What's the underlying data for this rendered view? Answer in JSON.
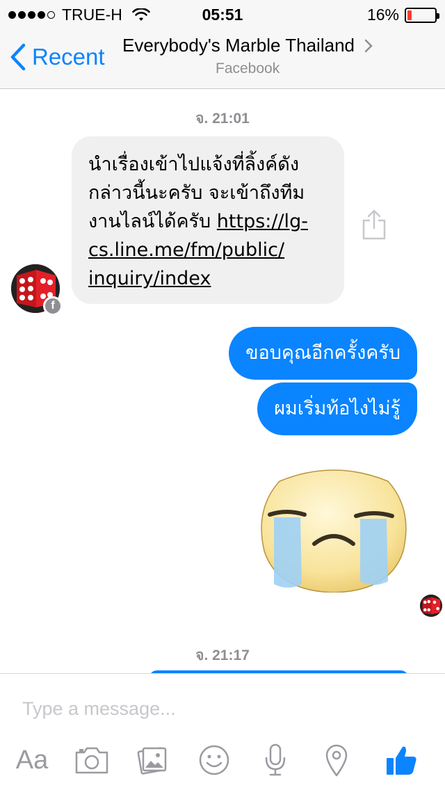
{
  "status_bar": {
    "carrier": "TRUE-H",
    "time": "05:51",
    "battery_percent": "16%",
    "battery_level": 0.16,
    "signal_icon": "signal-dots-icon",
    "wifi_icon": "wifi-icon"
  },
  "nav": {
    "back_label": "Recent",
    "title": "Everybody's Marble Thailand",
    "subtitle": "Facebook"
  },
  "chat": {
    "timestamp_1": "จ. 21:01",
    "incoming_line_1": "นำเรื่องเข้าไปแจ้งที่ลิ้งค์ดัง",
    "incoming_line_2": "กล่าวนี้นะครับ จะเข้าถึงทีม",
    "incoming_line_3": "งานไลน์ได้ครับ ",
    "incoming_link_1": "https://lg-",
    "incoming_link_2": "cs.line.me/fm/public/",
    "incoming_link_3": "inquiry/index",
    "outgoing_1": "ขอบคุณอีกครั้งครับ",
    "outgoing_2": "ผมเริ่มท้อไงไม่รู้",
    "timestamp_2": "จ. 21:17"
  },
  "composer": {
    "placeholder": "Type a message...",
    "text_tool": "Aa"
  },
  "colors": {
    "accent": "#0a84ff",
    "incoming_bubble": "#f1f0f0",
    "battery_low": "#ff3b30",
    "avatar_red": "#c4161c"
  }
}
